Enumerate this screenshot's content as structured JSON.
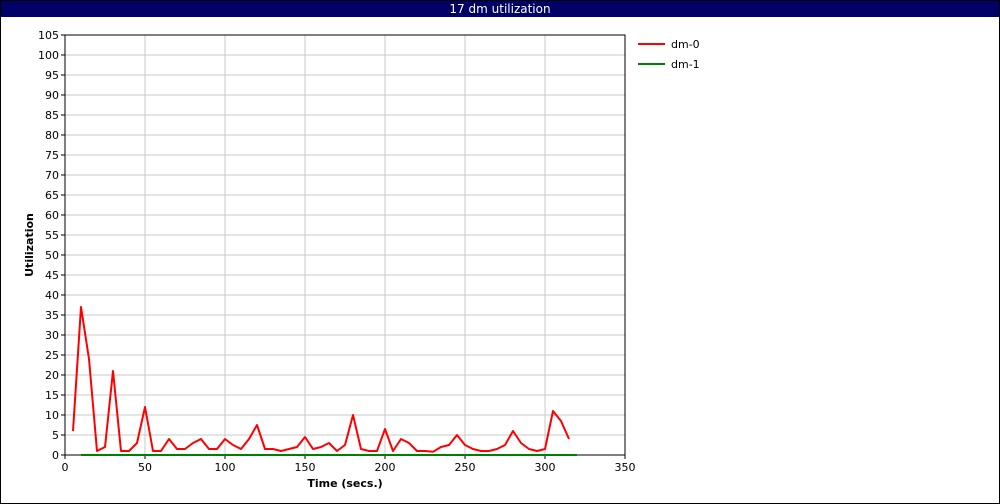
{
  "window": {
    "title": "17 dm utilization"
  },
  "chart_data": {
    "type": "line",
    "xlabel": "Time (secs.)",
    "ylabel": "Utilization",
    "xlim": [
      0,
      350
    ],
    "ylim": [
      0,
      105
    ],
    "xticks": [
      0,
      50,
      100,
      150,
      200,
      250,
      300,
      350
    ],
    "yticks": [
      0,
      5,
      10,
      15,
      20,
      25,
      30,
      35,
      40,
      45,
      50,
      55,
      60,
      65,
      70,
      75,
      80,
      85,
      90,
      95,
      100,
      105
    ],
    "grid": true,
    "legend_position": "top-right",
    "series": [
      {
        "name": "dm-0",
        "color": "#ff0000",
        "x": [
          5,
          10,
          15,
          20,
          25,
          30,
          35,
          40,
          45,
          50,
          55,
          60,
          65,
          70,
          75,
          80,
          85,
          90,
          95,
          100,
          105,
          110,
          115,
          120,
          125,
          130,
          135,
          140,
          145,
          150,
          155,
          160,
          165,
          170,
          175,
          180,
          185,
          190,
          195,
          200,
          205,
          210,
          215,
          220,
          225,
          230,
          235,
          240,
          245,
          250,
          255,
          260,
          265,
          270,
          275,
          280,
          285,
          290,
          295,
          300,
          305,
          310,
          315
        ],
        "y": [
          6,
          37,
          24,
          1,
          2,
          21,
          1,
          1,
          3,
          12,
          1,
          1,
          4,
          1.5,
          1.5,
          3,
          4,
          1.5,
          1.5,
          4,
          2.5,
          1.5,
          4,
          7.5,
          1.5,
          1.5,
          1,
          1.5,
          2,
          4.5,
          1.5,
          2,
          3,
          1,
          2.5,
          10,
          1.5,
          1,
          1,
          6.5,
          1,
          4,
          3,
          1,
          1,
          0.8,
          2,
          2.5,
          5,
          2.5,
          1.5,
          1,
          1,
          1.5,
          2.5,
          6,
          3,
          1.5,
          1,
          1.5,
          11,
          8.5,
          4
        ]
      },
      {
        "name": "dm-1",
        "color": "#008000",
        "x": [
          10,
          320
        ],
        "y": [
          0,
          0
        ]
      }
    ]
  }
}
